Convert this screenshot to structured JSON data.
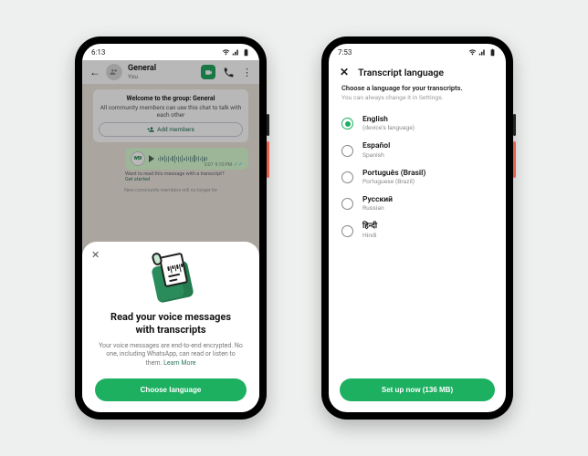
{
  "phone1": {
    "status": {
      "time": "6:13"
    },
    "chat": {
      "title": "General",
      "subtitle": "You",
      "welcome_title": "Welcome to the group: General",
      "welcome_body": "All community members can use this chat to talk with each other",
      "add_members": "Add members",
      "voice_avatar": "WBI",
      "voice_duration": "0:07",
      "voice_time": "9:10 PM",
      "hint_q": "Want to read this message with a transcript?",
      "hint_link": "Get started",
      "faded": "New community members will no longer be"
    },
    "sheet": {
      "title_l1": "Read your voice messages",
      "title_l2": "with transcripts",
      "body": "Your voice messages are end-to-end encrypted. No one, including WhatsApp, can read or listen to them.",
      "learn_more": "Learn More",
      "button": "Choose language"
    }
  },
  "phone2": {
    "status": {
      "time": "7:53"
    },
    "title": "Transcript language",
    "sub_l1": "Choose a language for your transcripts.",
    "sub_l2": "You can always change it in Settings.",
    "languages": [
      {
        "name": "English",
        "sub": "(device's language)",
        "selected": true
      },
      {
        "name": "Español",
        "sub": "Spanish",
        "selected": false
      },
      {
        "name": "Português (Brasil)",
        "sub": "Portuguese (Brazil)",
        "selected": false
      },
      {
        "name": "Русский",
        "sub": "Russian",
        "selected": false
      },
      {
        "name": "हिन्दी",
        "sub": "Hindi",
        "selected": false
      }
    ],
    "button": "Set up now (136 MB)"
  }
}
